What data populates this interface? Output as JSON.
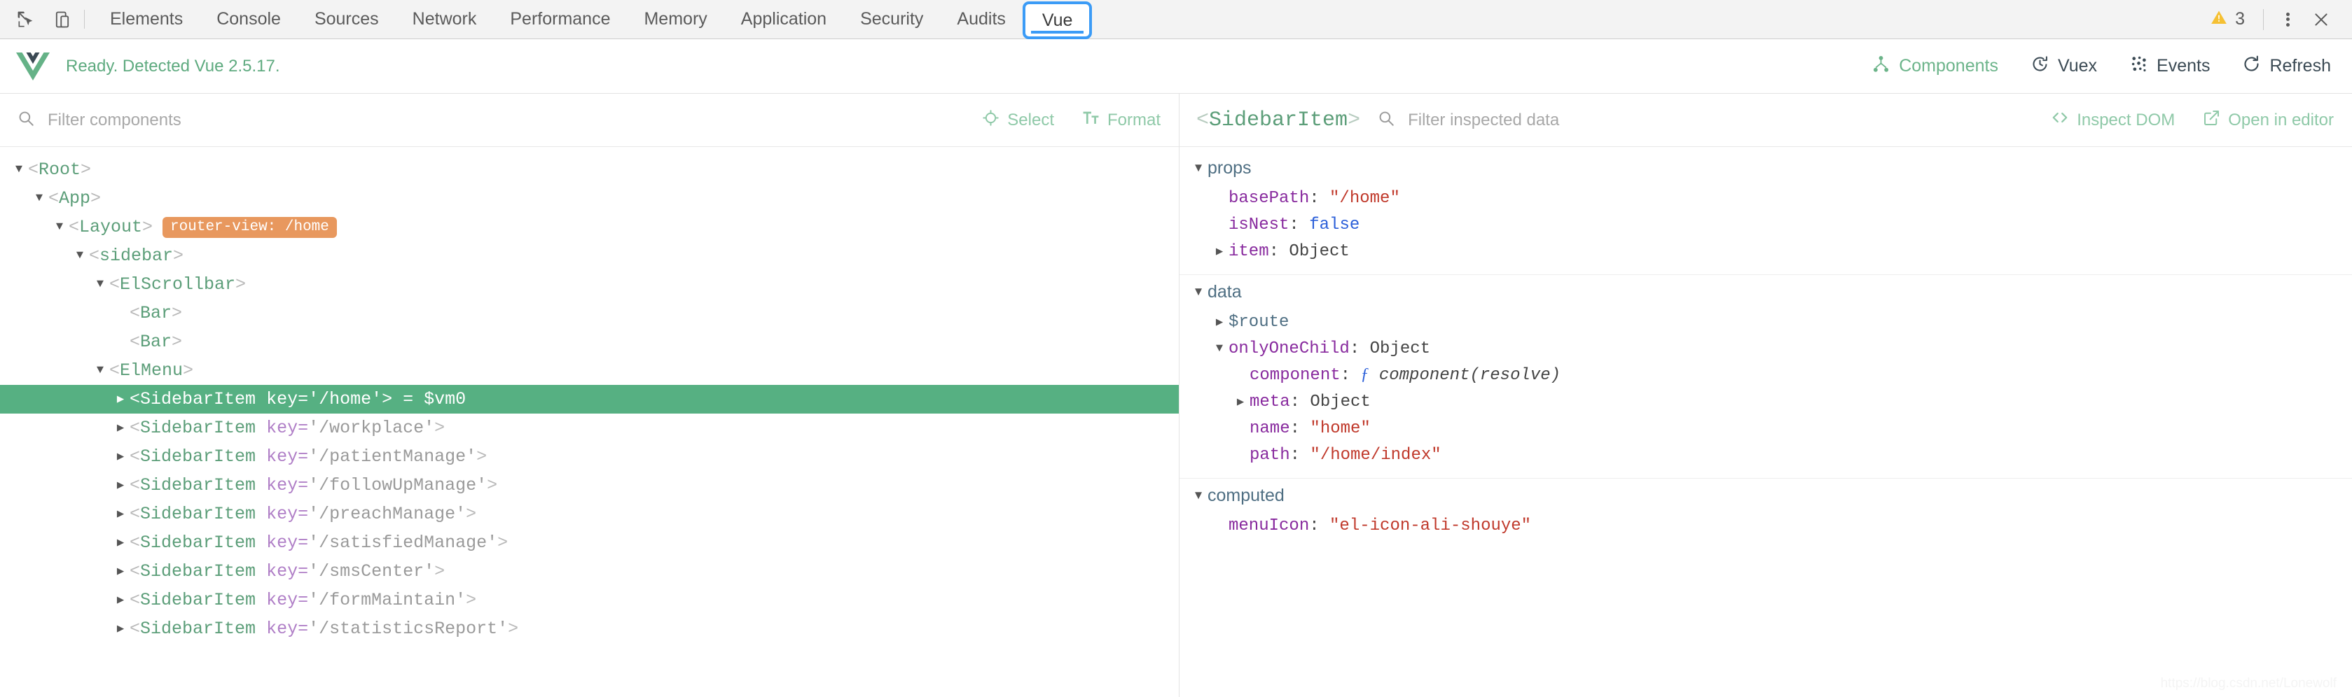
{
  "devtools": {
    "icons": [
      {
        "name": "inspect-element-icon"
      },
      {
        "name": "device-toolbar-icon"
      }
    ],
    "tabs": [
      {
        "label": "Elements",
        "selected": false
      },
      {
        "label": "Console",
        "selected": false
      },
      {
        "label": "Sources",
        "selected": false
      },
      {
        "label": "Network",
        "selected": false
      },
      {
        "label": "Performance",
        "selected": false
      },
      {
        "label": "Memory",
        "selected": false
      },
      {
        "label": "Application",
        "selected": false
      },
      {
        "label": "Security",
        "selected": false
      },
      {
        "label": "Audits",
        "selected": false
      },
      {
        "label": "Vue",
        "selected": true
      }
    ],
    "warning_count": "3",
    "warning_icon": "warning-triangle-icon",
    "menu_icon": "kebab-menu-icon",
    "close_icon": "close-icon"
  },
  "vue_header": {
    "logo_icon": "vue-logo-icon",
    "status": "Ready. Detected Vue 2.5.17.",
    "nav": [
      {
        "label": "Components",
        "icon": "components-tree-icon",
        "active": true
      },
      {
        "label": "Vuex",
        "icon": "vuex-clock-icon",
        "active": false
      },
      {
        "label": "Events",
        "icon": "events-dots-icon",
        "active": false
      },
      {
        "label": "Refresh",
        "icon": "refresh-icon",
        "active": false
      }
    ]
  },
  "left_pane": {
    "search": {
      "icon": "search-icon",
      "placeholder": "Filter components",
      "value": ""
    },
    "actions": [
      {
        "label": "Select",
        "icon": "select-target-icon"
      },
      {
        "label": "Format",
        "icon": "format-text-icon"
      }
    ],
    "tree": [
      {
        "depth": 0,
        "caret": "down",
        "name": "Root",
        "attr_key": "",
        "attr_val": "",
        "suffix": "",
        "badge": "",
        "selected": false
      },
      {
        "depth": 1,
        "caret": "down",
        "name": "App",
        "attr_key": "",
        "attr_val": "",
        "suffix": "",
        "badge": "",
        "selected": false
      },
      {
        "depth": 2,
        "caret": "down",
        "name": "Layout",
        "attr_key": "",
        "attr_val": "",
        "suffix": "",
        "badge": "router-view: /home",
        "selected": false
      },
      {
        "depth": 3,
        "caret": "down",
        "name": "sidebar",
        "attr_key": "",
        "attr_val": "",
        "suffix": "",
        "badge": "",
        "selected": false
      },
      {
        "depth": 4,
        "caret": "down",
        "name": "ElScrollbar",
        "attr_key": "",
        "attr_val": "",
        "suffix": "",
        "badge": "",
        "selected": false
      },
      {
        "depth": 5,
        "caret": "none",
        "name": "Bar",
        "attr_key": "",
        "attr_val": "",
        "suffix": "",
        "badge": "",
        "selected": false
      },
      {
        "depth": 5,
        "caret": "none",
        "name": "Bar",
        "attr_key": "",
        "attr_val": "",
        "suffix": "",
        "badge": "",
        "selected": false
      },
      {
        "depth": 4,
        "caret": "down",
        "name": "ElMenu",
        "attr_key": "",
        "attr_val": "",
        "suffix": "",
        "badge": "",
        "selected": false
      },
      {
        "depth": 5,
        "caret": "right",
        "name": "SidebarItem",
        "attr_key": "key=",
        "attr_val": "'/home'",
        "suffix": " = $vm0",
        "badge": "",
        "selected": true
      },
      {
        "depth": 5,
        "caret": "right",
        "name": "SidebarItem",
        "attr_key": "key=",
        "attr_val": "'/workplace'",
        "suffix": "",
        "badge": "",
        "selected": false
      },
      {
        "depth": 5,
        "caret": "right",
        "name": "SidebarItem",
        "attr_key": "key=",
        "attr_val": "'/patientManage'",
        "suffix": "",
        "badge": "",
        "selected": false
      },
      {
        "depth": 5,
        "caret": "right",
        "name": "SidebarItem",
        "attr_key": "key=",
        "attr_val": "'/followUpManage'",
        "suffix": "",
        "badge": "",
        "selected": false
      },
      {
        "depth": 5,
        "caret": "right",
        "name": "SidebarItem",
        "attr_key": "key=",
        "attr_val": "'/preachManage'",
        "suffix": "",
        "badge": "",
        "selected": false
      },
      {
        "depth": 5,
        "caret": "right",
        "name": "SidebarItem",
        "attr_key": "key=",
        "attr_val": "'/satisfiedManage'",
        "suffix": "",
        "badge": "",
        "selected": false
      },
      {
        "depth": 5,
        "caret": "right",
        "name": "SidebarItem",
        "attr_key": "key=",
        "attr_val": "'/smsCenter'",
        "suffix": "",
        "badge": "",
        "selected": false
      },
      {
        "depth": 5,
        "caret": "right",
        "name": "SidebarItem",
        "attr_key": "key=",
        "attr_val": "'/formMaintain'",
        "suffix": "",
        "badge": "",
        "selected": false
      },
      {
        "depth": 5,
        "caret": "right",
        "name": "SidebarItem",
        "attr_key": "key=",
        "attr_val": "'/statisticsReport'",
        "suffix": "",
        "badge": "",
        "selected": false
      }
    ]
  },
  "right_pane": {
    "inspected_component": "SidebarItem",
    "search": {
      "icon": "search-icon",
      "placeholder": "Filter inspected data",
      "value": ""
    },
    "actions": [
      {
        "label": "Inspect DOM",
        "icon": "code-brackets-icon"
      },
      {
        "label": "Open in editor",
        "icon": "external-link-icon"
      }
    ],
    "sections": [
      {
        "title": "props",
        "rows": [
          {
            "indent": 1,
            "caret": "none",
            "key": "basePath",
            "key_style": "purple",
            "value": "\"/home\"",
            "value_style": "string"
          },
          {
            "indent": 1,
            "caret": "none",
            "key": "isNest",
            "key_style": "purple",
            "value": "false",
            "value_style": "bool"
          },
          {
            "indent": 1,
            "caret": "right",
            "key": "item",
            "key_style": "purple",
            "value": "Object",
            "value_style": "object"
          }
        ]
      },
      {
        "title": "data",
        "rows": [
          {
            "indent": 1,
            "caret": "right",
            "key": "$route",
            "key_style": "blue",
            "value": "",
            "value_style": "none"
          },
          {
            "indent": 1,
            "caret": "down",
            "key": "onlyOneChild",
            "key_style": "purple",
            "value": "Object",
            "value_style": "object"
          },
          {
            "indent": 2,
            "caret": "none",
            "key": "component",
            "key_style": "purple",
            "value": "component(resolve)",
            "value_style": "function"
          },
          {
            "indent": 2,
            "caret": "right",
            "key": "meta",
            "key_style": "purple",
            "value": "Object",
            "value_style": "object"
          },
          {
            "indent": 2,
            "caret": "none",
            "key": "name",
            "key_style": "purple",
            "value": "\"home\"",
            "value_style": "string"
          },
          {
            "indent": 2,
            "caret": "none",
            "key": "path",
            "key_style": "purple",
            "value": "\"/home/index\"",
            "value_style": "string"
          }
        ]
      },
      {
        "title": "computed",
        "rows": [
          {
            "indent": 1,
            "caret": "none",
            "key": "menuIcon",
            "key_style": "purple",
            "value": "\"el-icon-ali-shouye\"",
            "value_style": "string"
          }
        ]
      }
    ],
    "watermark": "https://blog.csdn.net/Lonewolf"
  },
  "colors": {
    "accent_green": "#56b082",
    "vue_green": "#6cb48a",
    "tab_blue": "#3b9bf6",
    "badge_orange": "#e8985e",
    "string_red": "#c0392b",
    "key_purple": "#882a9e",
    "bool_blue": "#2b5fd9"
  }
}
